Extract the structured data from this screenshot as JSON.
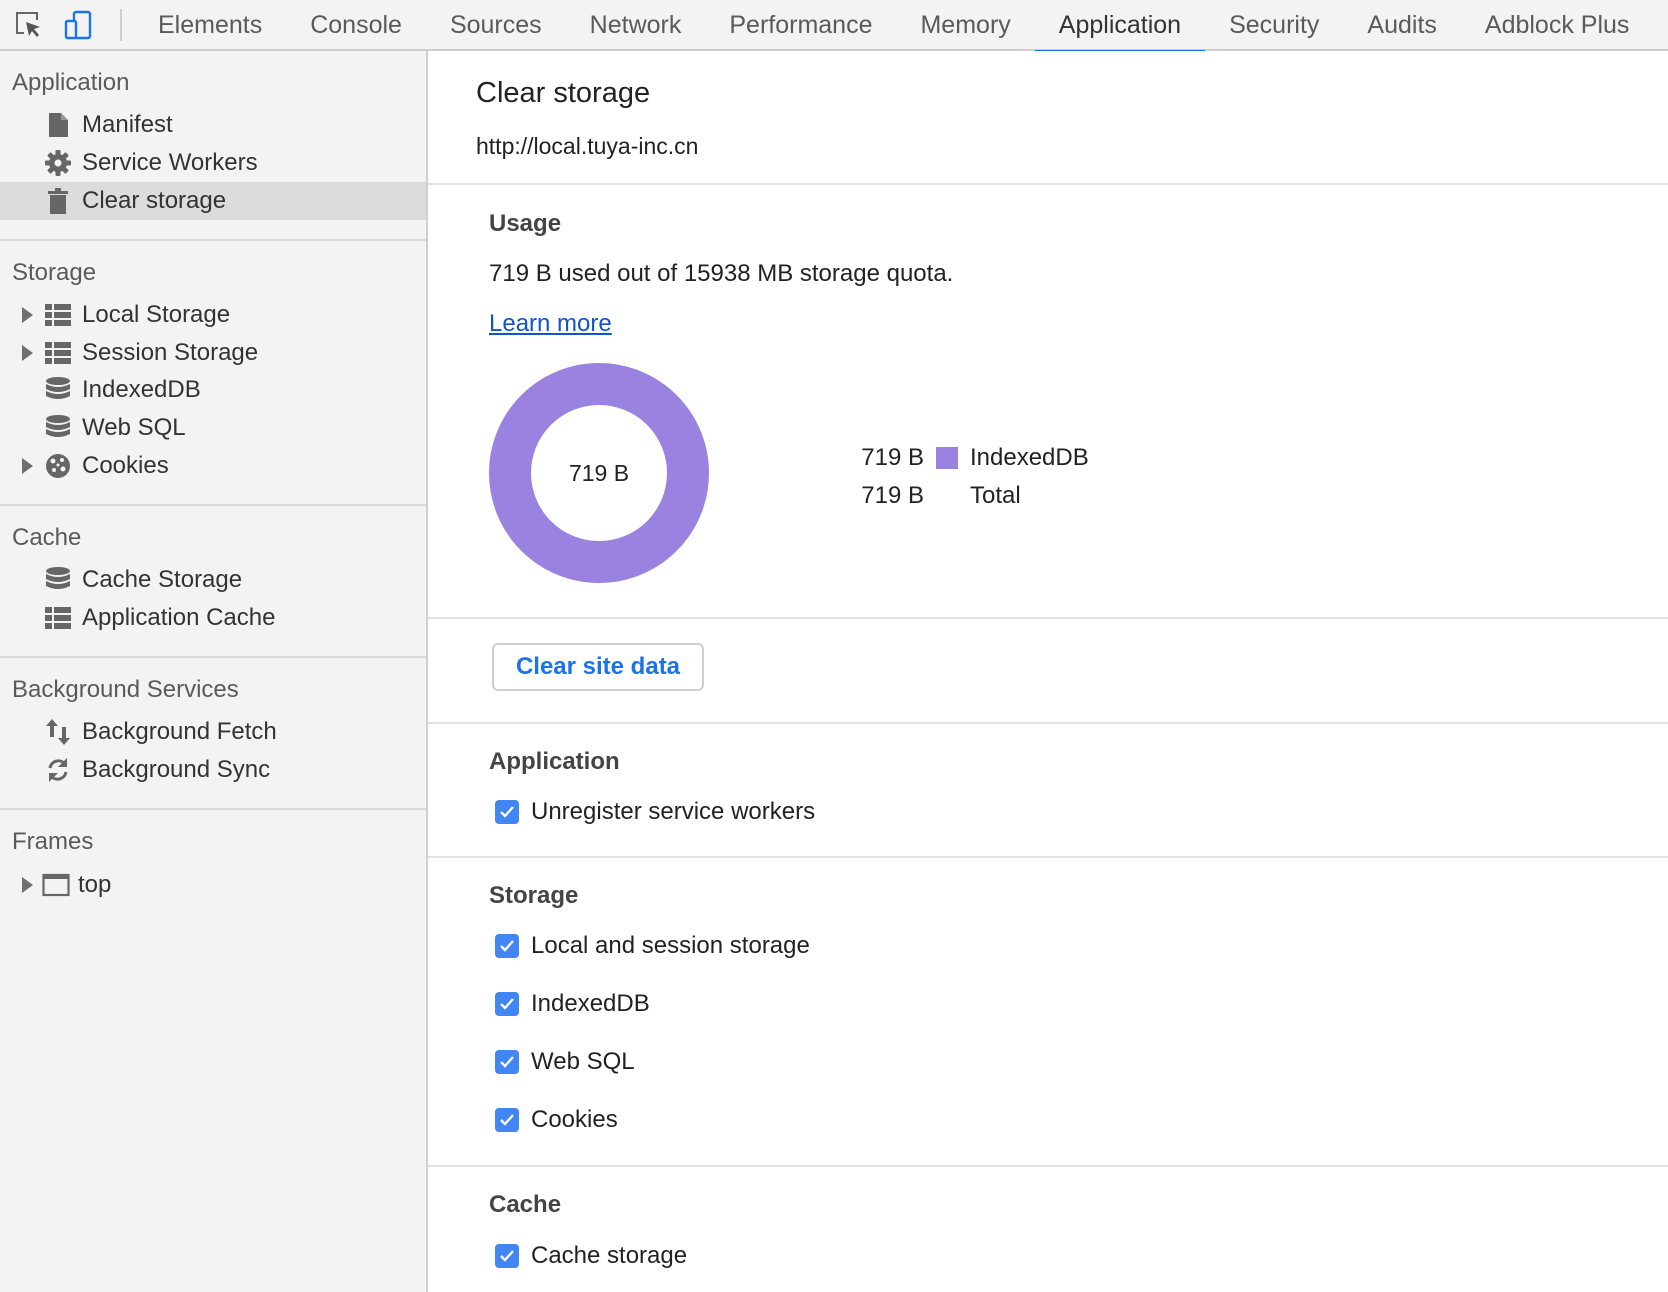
{
  "tabs": [
    {
      "label": "Elements"
    },
    {
      "label": "Console"
    },
    {
      "label": "Sources"
    },
    {
      "label": "Network"
    },
    {
      "label": "Performance"
    },
    {
      "label": "Memory"
    },
    {
      "label": "Application",
      "active": true
    },
    {
      "label": "Security"
    },
    {
      "label": "Audits"
    },
    {
      "label": "Adblock Plus"
    }
  ],
  "toolbar": {
    "inspect_icon": "inspect-element-icon",
    "device_icon": "device-toolbar-icon"
  },
  "sidebar": {
    "application": {
      "title": "Application",
      "items": [
        {
          "label": "Manifest",
          "icon": "document-icon"
        },
        {
          "label": "Service Workers",
          "icon": "gear-icon"
        },
        {
          "label": "Clear storage",
          "icon": "trash-icon",
          "selected": true
        }
      ]
    },
    "storage": {
      "title": "Storage",
      "items": [
        {
          "label": "Local Storage",
          "icon": "table-icon",
          "expandable": true
        },
        {
          "label": "Session Storage",
          "icon": "table-icon",
          "expandable": true
        },
        {
          "label": "IndexedDB",
          "icon": "database-icon"
        },
        {
          "label": "Web SQL",
          "icon": "database-icon"
        },
        {
          "label": "Cookies",
          "icon": "cookie-icon",
          "expandable": true
        }
      ]
    },
    "cache": {
      "title": "Cache",
      "items": [
        {
          "label": "Cache Storage",
          "icon": "database-icon"
        },
        {
          "label": "Application Cache",
          "icon": "table-icon"
        }
      ]
    },
    "background": {
      "title": "Background Services",
      "items": [
        {
          "label": "Background Fetch",
          "icon": "up-down-arrows-icon"
        },
        {
          "label": "Background Sync",
          "icon": "sync-icon"
        }
      ]
    },
    "frames": {
      "title": "Frames",
      "items": [
        {
          "label": "top",
          "icon": "frame-icon",
          "expandable": true
        }
      ]
    }
  },
  "main": {
    "title": "Clear storage",
    "origin": "http://local.tuya-inc.cn",
    "usage": {
      "heading": "Usage",
      "text": "719 B used out of 15938 MB storage quota.",
      "learn_more": "Learn more",
      "donut_center": "719 B",
      "legend": [
        {
          "value": "719 B",
          "name": "IndexedDB",
          "color": "#9a82e0"
        },
        {
          "value": "719 B",
          "name": "Total",
          "color": ""
        }
      ]
    },
    "clear_button": "Clear site data",
    "sections": [
      {
        "heading": "Application",
        "options": [
          {
            "label": "Unregister service workers",
            "checked": true
          }
        ]
      },
      {
        "heading": "Storage",
        "options": [
          {
            "label": "Local and session storage",
            "checked": true
          },
          {
            "label": "IndexedDB",
            "checked": true
          },
          {
            "label": "Web SQL",
            "checked": true
          },
          {
            "label": "Cookies",
            "checked": true
          }
        ]
      },
      {
        "heading": "Cache",
        "options": [
          {
            "label": "Cache storage",
            "checked": true
          }
        ]
      }
    ]
  },
  "colors": {
    "accent": "#1a73e8",
    "checkbox": "#4285f4",
    "indexeddb": "#9a82e0",
    "link": "#1155cc"
  }
}
